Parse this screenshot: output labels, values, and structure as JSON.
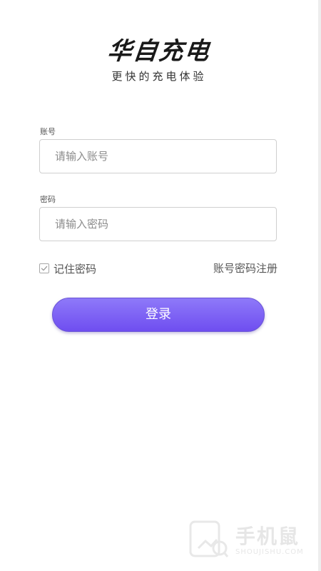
{
  "app": {
    "title": "华自充电",
    "tagline": "更快的充电体验"
  },
  "form": {
    "account_label": "账号",
    "account_placeholder": "请输入账号",
    "password_label": "密码",
    "password_placeholder": "请输入密码",
    "remember_label": "记住密码",
    "remember_checked": true,
    "register_link": "账号密码注册",
    "login_button": "登录"
  },
  "watermark": {
    "text": "手机鼠",
    "sub": "SHOUJISHU.COM"
  },
  "colors": {
    "accent": "#7b63f5",
    "text": "#1a1a1a",
    "muted": "#8c8c8c",
    "border": "#cfcfcf"
  }
}
